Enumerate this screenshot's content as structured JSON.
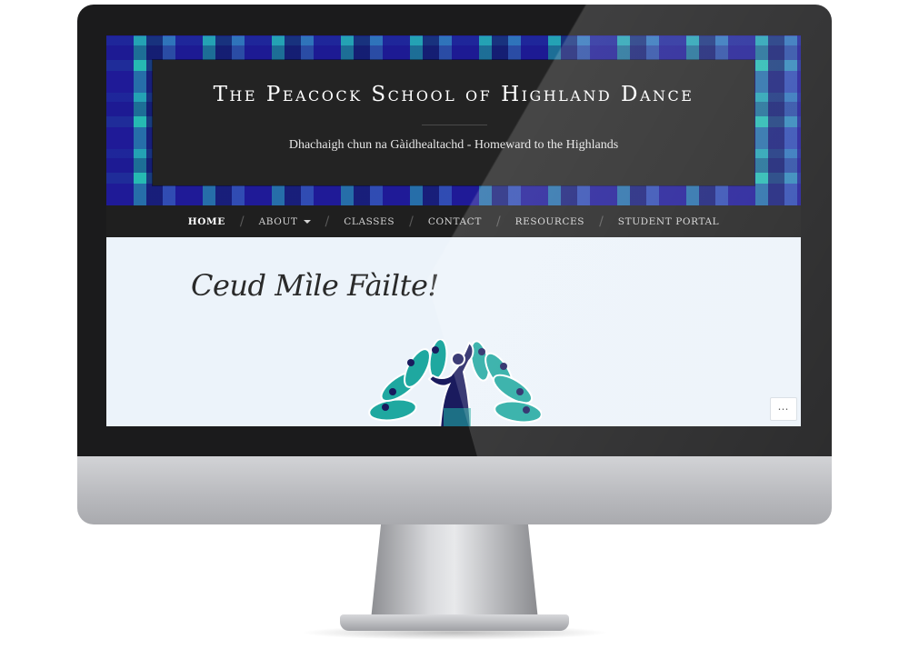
{
  "site": {
    "title": "The Peacock School of Highland Dance",
    "tagline": "Dhachaigh chun na Gàidhealtachd - Homeward to the Highlands"
  },
  "nav": {
    "items": [
      {
        "label": "Home",
        "active": true
      },
      {
        "label": "About",
        "has_dropdown": true
      },
      {
        "label": "Classes"
      },
      {
        "label": "Contact"
      },
      {
        "label": "Resources"
      },
      {
        "label": "Student Portal"
      }
    ],
    "separator": "/"
  },
  "main": {
    "heading": "Ceud Mìle Fàilte!",
    "logo_icon": "peacock-dancer-logo-icon"
  },
  "actions": {
    "more_label": "⋯",
    "more_icon": "ellipsis-icon"
  },
  "colors": {
    "tartan_navy": "#1f1a8a",
    "tartan_teal": "#2bc4b4",
    "panel_dark": "#232323",
    "content_bg": "#ecf3fa",
    "logo_teal": "#1fa8a0",
    "logo_navy": "#1a1b5e"
  }
}
